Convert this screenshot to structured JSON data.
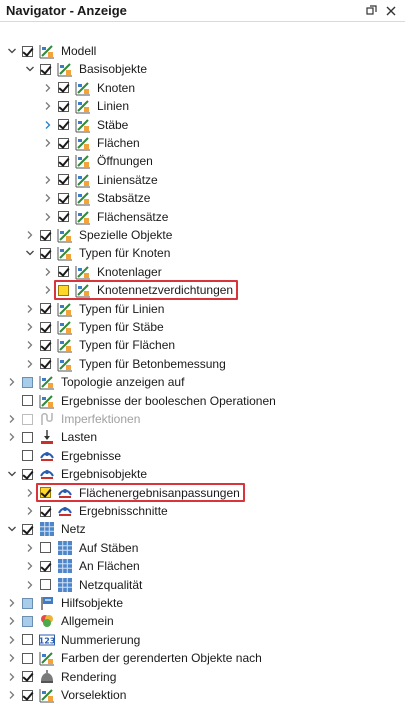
{
  "panel": {
    "title": "Navigator - Anzeige",
    "pin_icon": "pin-icon",
    "close_icon": "close-icon"
  },
  "colors": {
    "highlight_box": "#d8343b",
    "partial_checkbox": "#a7cdeb",
    "highlight_checkbox": "#ffd829"
  },
  "tree": [
    {
      "label": "Modell",
      "level": 0,
      "expander": "open",
      "check": "checked",
      "icon": "model-icon"
    },
    {
      "label": "Basisobjekte",
      "level": 1,
      "expander": "open",
      "check": "checked",
      "icon": "model-icon"
    },
    {
      "label": "Knoten",
      "level": 2,
      "expander": "closed",
      "check": "checked",
      "icon": "model-icon"
    },
    {
      "label": "Linien",
      "level": 2,
      "expander": "closed",
      "check": "checked",
      "icon": "model-icon"
    },
    {
      "label": "Stäbe",
      "level": 2,
      "expander": "closed-active",
      "check": "checked",
      "icon": "model-icon"
    },
    {
      "label": "Flächen",
      "level": 2,
      "expander": "closed",
      "check": "checked",
      "icon": "model-icon"
    },
    {
      "label": "Öffnungen",
      "level": 2,
      "expander": "none",
      "check": "checked",
      "icon": "model-icon"
    },
    {
      "label": "Liniensätze",
      "level": 2,
      "expander": "closed",
      "check": "checked",
      "icon": "model-icon"
    },
    {
      "label": "Stabsätze",
      "level": 2,
      "expander": "closed",
      "check": "checked",
      "icon": "model-icon"
    },
    {
      "label": "Flächensätze",
      "level": 2,
      "expander": "closed",
      "check": "checked",
      "icon": "model-icon"
    },
    {
      "label": "Spezielle Objekte",
      "level": 1,
      "expander": "closed",
      "check": "checked",
      "icon": "model-icon"
    },
    {
      "label": "Typen für Knoten",
      "level": 1,
      "expander": "open",
      "check": "checked",
      "icon": "model-icon"
    },
    {
      "label": "Knotenlager",
      "level": 2,
      "expander": "closed",
      "check": "checked",
      "icon": "model-icon"
    },
    {
      "label": "Knotennetzverdichtungen",
      "level": 2,
      "expander": "closed",
      "check": "highlight",
      "icon": "model-icon",
      "boxed": true
    },
    {
      "label": "Typen für Linien",
      "level": 1,
      "expander": "closed",
      "check": "checked",
      "icon": "model-icon"
    },
    {
      "label": "Typen für Stäbe",
      "level": 1,
      "expander": "closed",
      "check": "checked",
      "icon": "model-icon"
    },
    {
      "label": "Typen für Flächen",
      "level": 1,
      "expander": "closed",
      "check": "checked",
      "icon": "model-icon"
    },
    {
      "label": "Typen für Betonbemessung",
      "level": 1,
      "expander": "closed",
      "check": "checked",
      "icon": "model-icon"
    },
    {
      "label": "Topologie anzeigen auf",
      "level": 0,
      "expander": "closed",
      "check": "partial",
      "icon": "model-icon"
    },
    {
      "label": "Ergebnisse der booleschen Operationen",
      "level": 0,
      "expander": "none",
      "check": "unchecked",
      "icon": "model-icon"
    },
    {
      "label": "Imperfektionen",
      "level": 0,
      "expander": "closed",
      "check": "disabled",
      "icon": "imperfection-icon",
      "disabled": true
    },
    {
      "label": "Lasten",
      "level": 0,
      "expander": "closed",
      "check": "unchecked",
      "icon": "load-icon"
    },
    {
      "label": "Ergebnisse",
      "level": 0,
      "expander": "none",
      "check": "unchecked",
      "icon": "result-icon"
    },
    {
      "label": "Ergebnisobjekte",
      "level": 0,
      "expander": "open",
      "check": "checked",
      "icon": "result-icon"
    },
    {
      "label": "Flächenergebnisanpassungen",
      "level": 1,
      "expander": "closed",
      "check": "highlight-checked",
      "icon": "result-icon",
      "boxed": true
    },
    {
      "label": "Ergebnisschnitte",
      "level": 1,
      "expander": "closed",
      "check": "checked",
      "icon": "result-icon"
    },
    {
      "label": "Netz",
      "level": 0,
      "expander": "open",
      "check": "checked",
      "icon": "mesh-icon"
    },
    {
      "label": "Auf Stäben",
      "level": 1,
      "expander": "closed",
      "check": "unchecked",
      "icon": "mesh-icon"
    },
    {
      "label": "An Flächen",
      "level": 1,
      "expander": "closed",
      "check": "checked",
      "icon": "mesh-icon"
    },
    {
      "label": "Netzqualität",
      "level": 1,
      "expander": "closed",
      "check": "unchecked",
      "icon": "mesh-icon"
    },
    {
      "label": "Hilfsobjekte",
      "level": 0,
      "expander": "closed",
      "check": "partial",
      "icon": "guide-icon"
    },
    {
      "label": "Allgemein",
      "level": 0,
      "expander": "closed",
      "check": "partial",
      "icon": "general-icon"
    },
    {
      "label": "Nummerierung",
      "level": 0,
      "expander": "closed",
      "check": "unchecked",
      "icon": "numbering-icon"
    },
    {
      "label": "Farben der gerenderten Objekte nach",
      "level": 0,
      "expander": "closed",
      "check": "unchecked",
      "icon": "model-icon"
    },
    {
      "label": "Rendering",
      "level": 0,
      "expander": "closed",
      "check": "checked",
      "icon": "rendering-icon"
    },
    {
      "label": "Vorselektion",
      "level": 0,
      "expander": "closed",
      "check": "checked",
      "icon": "model-icon"
    }
  ]
}
